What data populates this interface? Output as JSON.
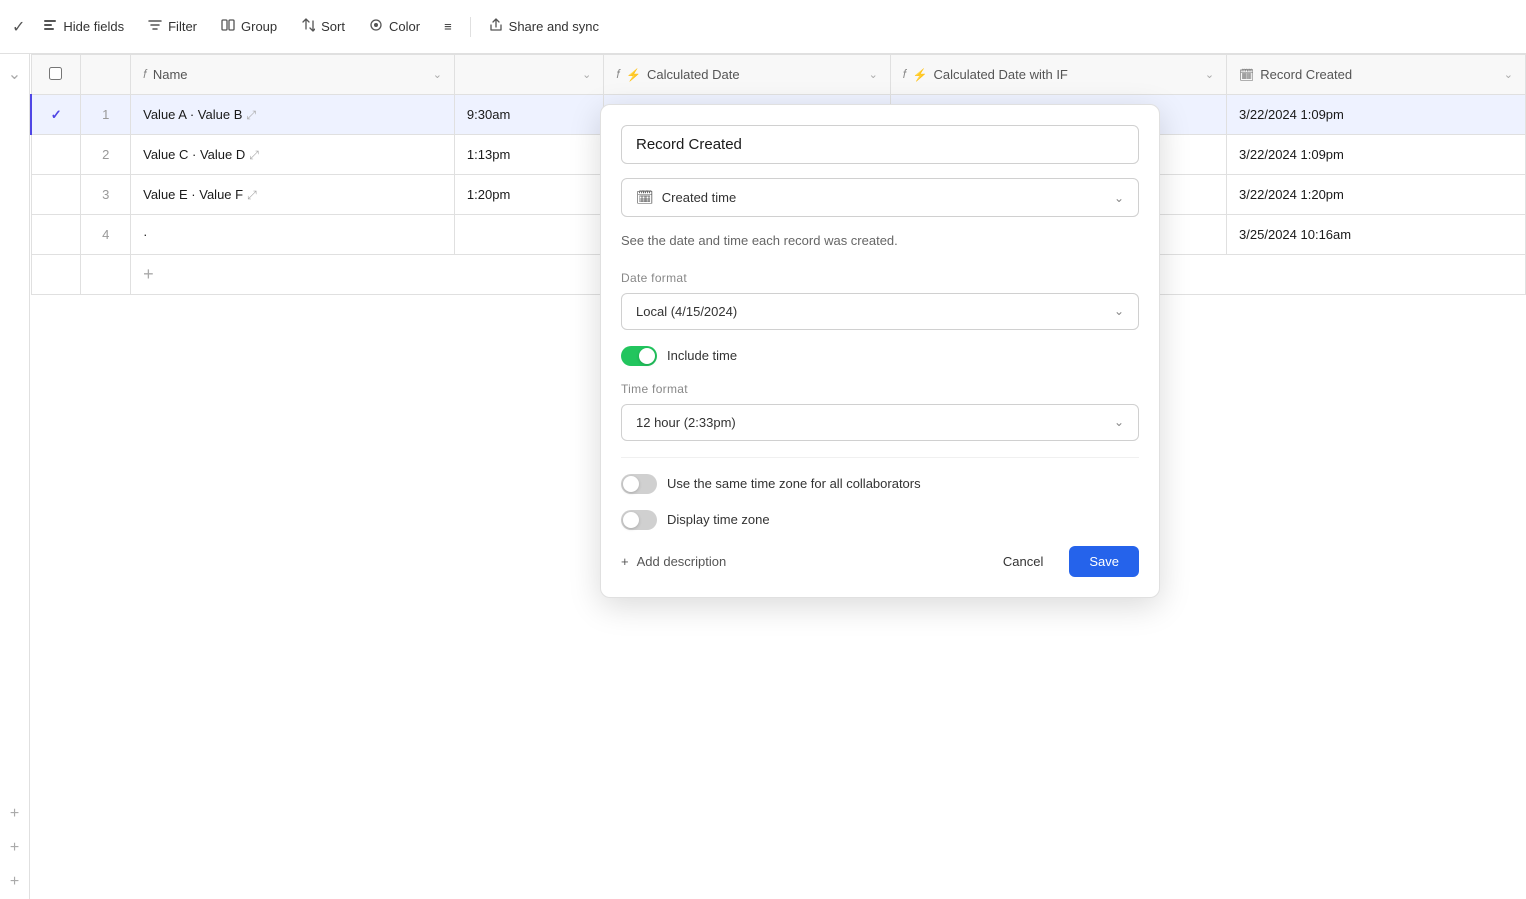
{
  "toolbar": {
    "hide_fields": "Hide fields",
    "filter": "Filter",
    "group": "Group",
    "sort": "Sort",
    "color": "Color",
    "density_icon": "≡",
    "share_sync": "Share and sync"
  },
  "table": {
    "columns": [
      {
        "id": "check",
        "label": ""
      },
      {
        "id": "num",
        "label": ""
      },
      {
        "id": "name",
        "label": "Name"
      },
      {
        "id": "time",
        "label": ""
      },
      {
        "id": "calc",
        "label": "Calculated Date"
      },
      {
        "id": "calcif",
        "label": "Calculated Date with IF"
      },
      {
        "id": "created",
        "label": "Record Created"
      }
    ],
    "rows": [
      {
        "num": "1",
        "name": "Value A · Value B",
        "time": "9:30am",
        "calc": "",
        "calcif": "",
        "created": "3/22/2024   1:09pm"
      },
      {
        "num": "2",
        "name": "Value C · Value D",
        "time": "1:13pm",
        "calc": "",
        "calcif": "",
        "created": "3/22/2024   1:09pm"
      },
      {
        "num": "3",
        "name": "Value E · Value F",
        "time": "1:20pm",
        "calc": "",
        "calcif": "",
        "created": "3/22/2024   1:20pm"
      },
      {
        "num": "4",
        "name": "·",
        "time": "",
        "calc": "",
        "calcif": "",
        "created": "3/25/2024   10:16am"
      }
    ]
  },
  "panel": {
    "title": "Record Created",
    "field_type_icon": "📅",
    "field_type": "Created time",
    "description": "See the date and time each record was created.",
    "date_format_label": "Date format",
    "date_format_value": "Local (4/15/2024)",
    "include_time_label": "Include time",
    "include_time_on": true,
    "time_format_label": "Time format",
    "time_format_value": "12 hour (2:33pm)",
    "same_timezone_label": "Use the same time zone for all collaborators",
    "same_timezone_on": false,
    "display_timezone_label": "Display time zone",
    "display_timezone_on": false,
    "add_description": "+ Add description",
    "cancel": "Cancel",
    "save": "Save"
  },
  "sidebar": {
    "expand_icon": "⌄",
    "plus_icons": [
      "+",
      "+",
      "+"
    ]
  }
}
